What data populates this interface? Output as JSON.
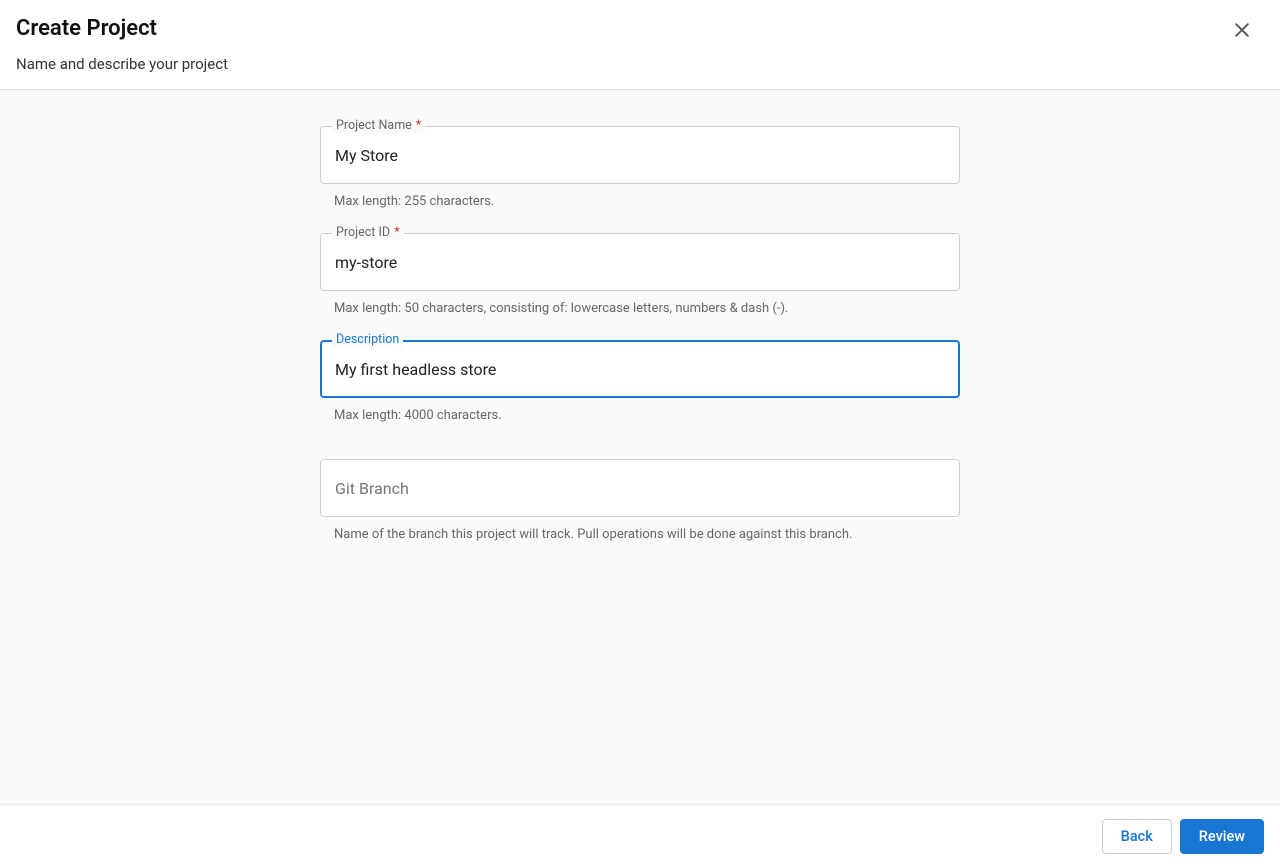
{
  "header": {
    "title": "Create Project",
    "subtitle": "Name and describe your project"
  },
  "fields": {
    "projectName": {
      "label": "Project Name",
      "required": "*",
      "value": "My Store",
      "helper": "Max length: 255 characters."
    },
    "projectId": {
      "label": "Project ID",
      "required": "*",
      "value": "my-store",
      "helper": "Max length: 50 characters, consisting of: lowercase letters, numbers & dash (-)."
    },
    "description": {
      "label": "Description",
      "value": "My first headless store",
      "helper": "Max length: 4000 characters."
    },
    "gitBranch": {
      "placeholder": "Git Branch",
      "value": "",
      "helper": "Name of the branch this project will track. Pull operations will be done against this branch."
    }
  },
  "footer": {
    "back": "Back",
    "review": "Review"
  }
}
